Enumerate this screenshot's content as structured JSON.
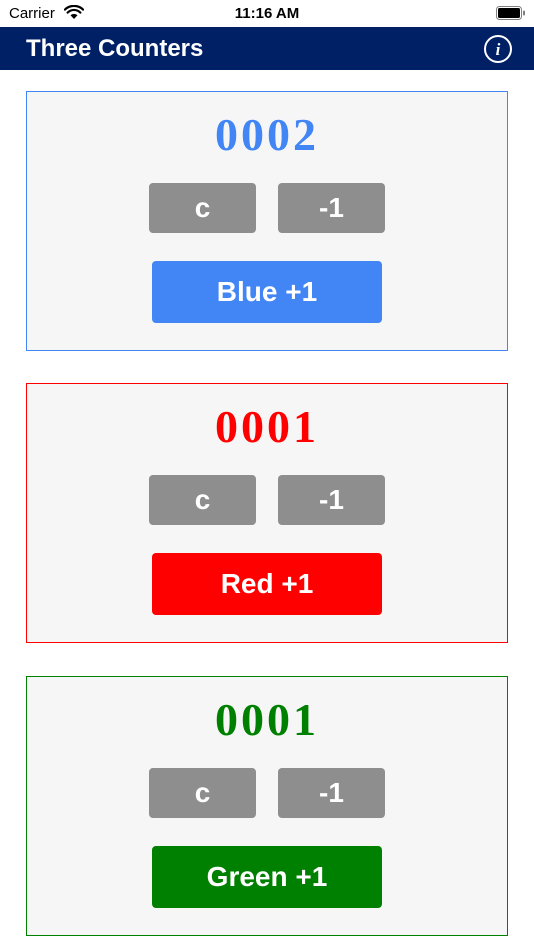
{
  "status_bar": {
    "carrier": "Carrier",
    "time": "11:16 AM",
    "icons": [
      "wifi-icon",
      "battery-icon"
    ]
  },
  "nav_bar": {
    "title": "Three Counters",
    "info_icon": "info-icon",
    "info_glyph": "i",
    "background": "#002066"
  },
  "counters": [
    {
      "id": "blue",
      "color": "#4285f4",
      "value": "0002",
      "clear_label": "c",
      "decrement_label": "-1",
      "increment_label": "Blue +1"
    },
    {
      "id": "red",
      "color": "#ff0000",
      "value": "0001",
      "clear_label": "c",
      "decrement_label": "-1",
      "increment_label": "Red +1"
    },
    {
      "id": "green",
      "color": "#008000",
      "value": "0001",
      "clear_label": "c",
      "decrement_label": "-1",
      "increment_label": "Green +1"
    }
  ],
  "colors": {
    "card_background": "#f6f6f6",
    "secondary_button": "#8e8e8e"
  }
}
